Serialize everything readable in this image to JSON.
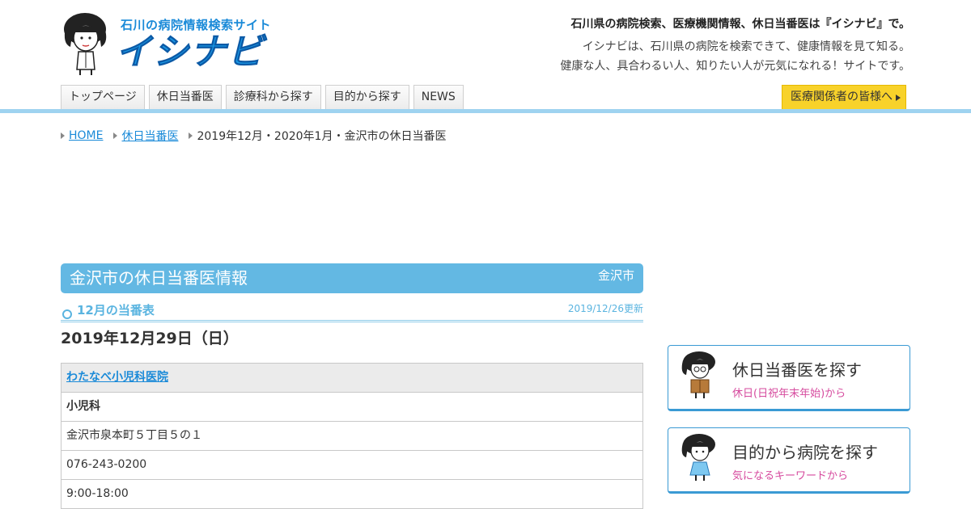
{
  "header": {
    "logo_tag": "石川の病院情報検索サイト",
    "logo_name": "イシナビ",
    "tagline_bold": "石川県の病院検索、医療機関情報、休日当番医は『イシナビ』で。",
    "tagline_line1": "イシナビは、石川県の病院を検索できて、健康情報を見て知る。",
    "tagline_line2": "健康な人、具合わるい人、知りたい人が元気になれる！サイトです。"
  },
  "nav": {
    "items": [
      "トップページ",
      "休日当番医",
      "診療科から探す",
      "目的から探す",
      "NEWS"
    ],
    "pro_button": "医療関係者の皆様へ"
  },
  "breadcrumb": {
    "home": "HOME",
    "holiday": "休日当番医",
    "current": "2019年12月・2020年1月・金沢市の休日当番医"
  },
  "main": {
    "page_title": "金沢市の休日当番医情報",
    "city": "金沢市",
    "section_title": "12月の当番表",
    "updated": "2019/12/26更新",
    "date": "2019年12月29日（日）",
    "clinic": {
      "name": "わたなべ小児科医院",
      "department": "小児科",
      "address": "金沢市泉本町５丁目５の１",
      "phone": "076-243-0200",
      "hours": "9:00-18:00"
    }
  },
  "sidebar": {
    "cards": [
      {
        "title": "休日当番医を探す",
        "sub": "休日(日祝年末年始)から"
      },
      {
        "title": "目的から病院を探す",
        "sub": "気になるキーワードから"
      }
    ]
  },
  "colors": {
    "accent": "#63b8e3",
    "link": "#1a8ad8",
    "highlight": "#f8d22a",
    "pink": "#d64a9e"
  }
}
